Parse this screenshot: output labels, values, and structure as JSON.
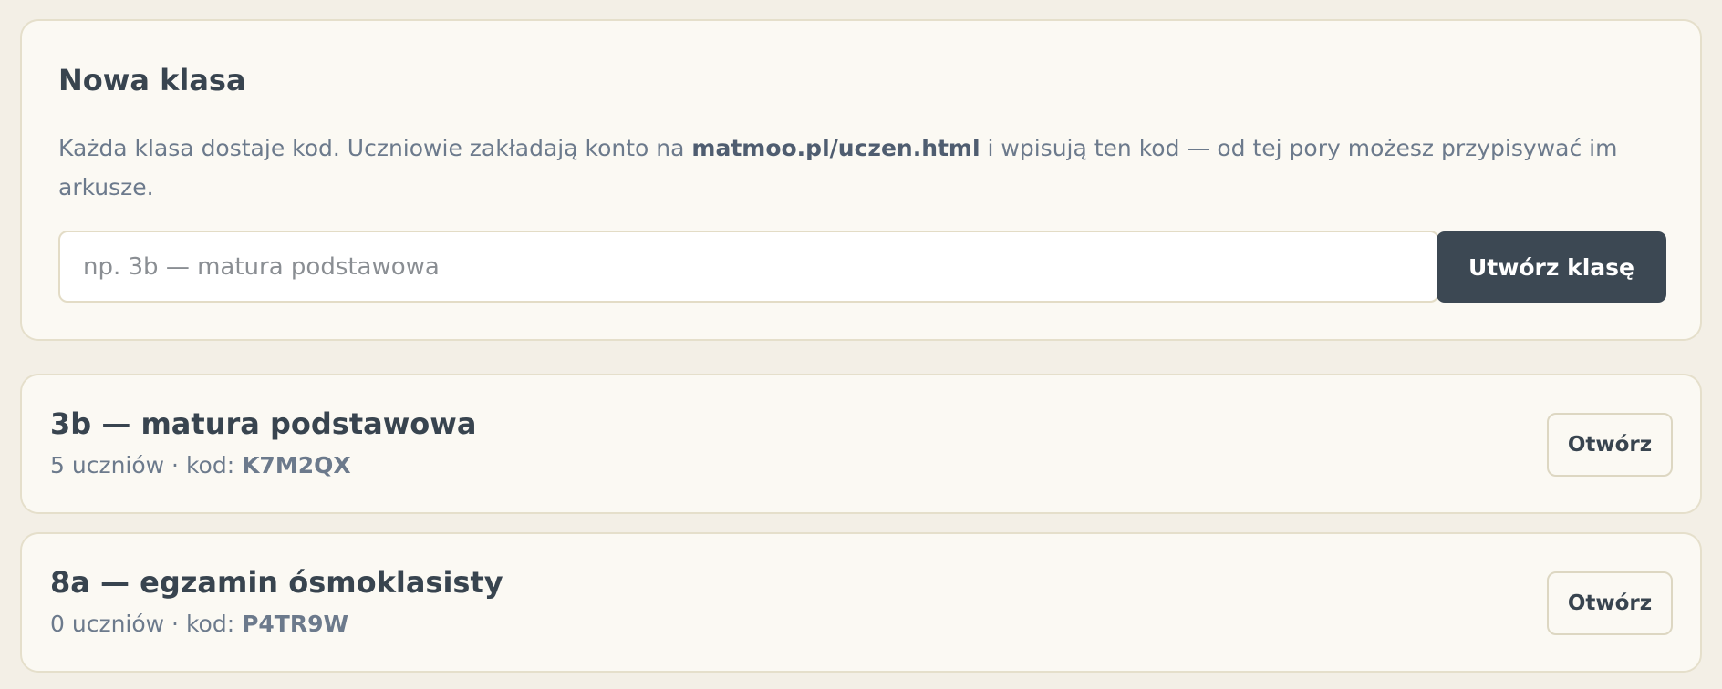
{
  "new_class": {
    "title": "Nowa klasa",
    "description_before": "Każda klasa dostaje kod. Uczniowie zakładają konto na ",
    "description_link": "matmoo.pl/uczen.html",
    "description_after": " i wpisują ten kod — od tej pory możesz przypisywać im arkusze.",
    "input_placeholder": "np. 3b — matura podstawowa",
    "input_value": "",
    "create_button_label": "Utwórz klasę"
  },
  "classes": [
    {
      "name": "3b — matura podstawowa",
      "students_text": "5 uczniów · kod: ",
      "code": "K7M2QX",
      "open_label": "Otwórz"
    },
    {
      "name": "8a — egzamin ósmoklasisty",
      "students_text": "0 uczniów · kod: ",
      "code": "P4TR9W",
      "open_label": "Otwórz"
    }
  ],
  "colors": {
    "background": "#f3efe6",
    "card": "#fbf9f3",
    "card_border": "#e5dfcb",
    "primary_button": "#3c4853",
    "text": "#38444f",
    "muted_text": "#6c7a8c"
  }
}
